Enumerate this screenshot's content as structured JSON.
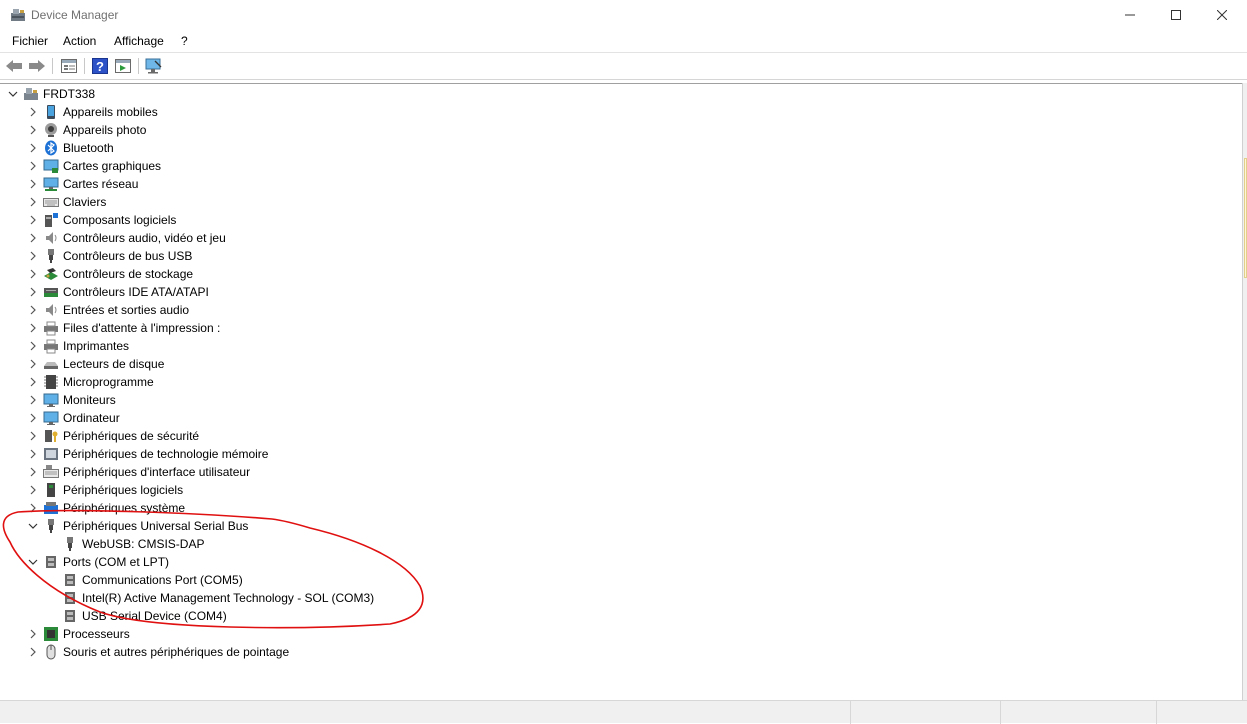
{
  "window": {
    "title": "Device Manager"
  },
  "menu": [
    {
      "label": "Fichier"
    },
    {
      "label": "Action"
    },
    {
      "label": "Affichage"
    },
    {
      "label": "?"
    }
  ],
  "toolbar": [
    "back-arrow-icon",
    "forward-arrow-icon",
    "properties-icon",
    "help-icon",
    "update-driver-icon",
    "scan-hardware-icon"
  ],
  "tree": {
    "root": {
      "label": "FRDT338",
      "expanded": true
    },
    "categories": [
      {
        "label": "Appareils mobiles",
        "icon": "mobile-device-icon"
      },
      {
        "label": "Appareils photo",
        "icon": "camera-icon"
      },
      {
        "label": "Bluetooth",
        "icon": "bluetooth-icon"
      },
      {
        "label": "Cartes graphiques",
        "icon": "display-adapter-icon"
      },
      {
        "label": "Cartes réseau",
        "icon": "network-adapter-icon"
      },
      {
        "label": "Claviers",
        "icon": "keyboard-icon"
      },
      {
        "label": "Composants logiciels",
        "icon": "software-component-icon"
      },
      {
        "label": "Contrôleurs audio, vidéo et jeu",
        "icon": "speaker-icon"
      },
      {
        "label": "Contrôleurs de bus USB",
        "icon": "usb-icon"
      },
      {
        "label": "Contrôleurs de stockage",
        "icon": "storage-controller-icon"
      },
      {
        "label": "Contrôleurs IDE ATA/ATAPI",
        "icon": "ide-controller-icon"
      },
      {
        "label": "Entrées et sorties audio",
        "icon": "speaker-icon"
      },
      {
        "label": "Files d'attente à l'impression :",
        "icon": "print-queue-icon"
      },
      {
        "label": "Imprimantes",
        "icon": "printer-icon"
      },
      {
        "label": "Lecteurs de disque",
        "icon": "disk-drive-icon"
      },
      {
        "label": "Microprogramme",
        "icon": "firmware-icon"
      },
      {
        "label": "Moniteurs",
        "icon": "monitor-icon"
      },
      {
        "label": "Ordinateur",
        "icon": "computer-icon"
      },
      {
        "label": "Périphériques de sécurité",
        "icon": "security-device-icon"
      },
      {
        "label": "Périphériques de technologie mémoire",
        "icon": "memory-device-icon"
      },
      {
        "label": "Périphériques d'interface utilisateur",
        "icon": "hid-icon"
      },
      {
        "label": "Périphériques logiciels",
        "icon": "software-device-icon"
      },
      {
        "label": "Périphériques système",
        "icon": "system-device-icon"
      },
      {
        "label": "Périphériques Universal Serial Bus",
        "icon": "usb-icon",
        "expanded": true,
        "children": [
          {
            "label": "WebUSB: CMSIS-DAP",
            "icon": "usb-icon"
          }
        ]
      },
      {
        "label": "Ports (COM et LPT)",
        "icon": "port-icon",
        "expanded": true,
        "children": [
          {
            "label": "Communications Port (COM5)",
            "icon": "port-icon"
          },
          {
            "label": "Intel(R) Active Management Technology - SOL (COM3)",
            "icon": "port-icon"
          },
          {
            "label": "USB Serial Device (COM4)",
            "icon": "port-icon"
          }
        ]
      },
      {
        "label": "Processeurs",
        "icon": "processor-icon"
      },
      {
        "label": "Souris et autres périphériques de pointage",
        "icon": "mouse-icon"
      }
    ]
  },
  "colors": {
    "annotation": "#e01010",
    "accent": "#1e72d6"
  }
}
